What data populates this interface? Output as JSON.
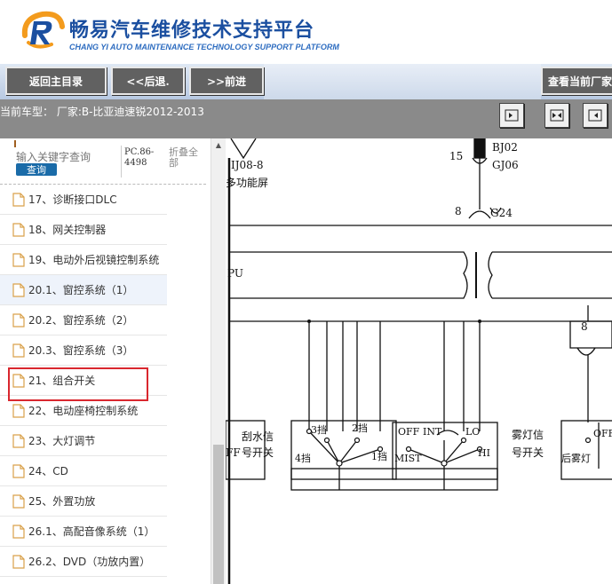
{
  "header": {
    "title_cn": "畅易汽车维修技术支持平台",
    "title_en": "CHANG YI AUTO MAINTENANCE TECHNOLOGY SUPPORT PLATFORM"
  },
  "nav": {
    "home_label": "返回主目录",
    "back_label": "<<后退.",
    "forward_label": ">>前进",
    "view_current_label": "查看当前厂家"
  },
  "car_info": {
    "text": "当前车型： 厂家:B-比亚迪速锐2012-2013"
  },
  "search": {
    "placeholder": "输入关键字查询",
    "button_label": "查询",
    "pc_code": "PC.86-4498",
    "collapse_label": "折叠全部"
  },
  "sidebar": {
    "items": [
      {
        "label": "17、诊断接口DLC"
      },
      {
        "label": "18、网关控制器"
      },
      {
        "label": "19、电动外后视镜控制系统"
      },
      {
        "label": "20.1、窗控系统（1）"
      },
      {
        "label": "20.2、窗控系统（2）"
      },
      {
        "label": "20.3、窗控系统（3）"
      },
      {
        "label": "21、组合开关"
      },
      {
        "label": "22、电动座椅控制系统"
      },
      {
        "label": "23、大灯调节"
      },
      {
        "label": "24、CD"
      },
      {
        "label": "25、外置功放"
      },
      {
        "label": "26.1、高配音像系统（1）"
      },
      {
        "label": "26.2、DVD（功放内置）"
      }
    ],
    "active_index": 3,
    "highlighted_index": 6
  },
  "diagram": {
    "labels": {
      "connector_left": "IJ08-8",
      "multi_screen": "多功能屏",
      "pin_15": "15",
      "bj02": "BJ02",
      "gj06": "GJ06",
      "pin_8": "8",
      "g24": "G24",
      "pu": "PU",
      "pin_8b": "8",
      "wiper_signal_1": "刮水信",
      "wiper_signal_2": "号开关",
      "ff": "FF",
      "gear_3": "3挡",
      "gear_2": "2挡",
      "gear_4": "4挡",
      "gear_1": "1挡",
      "off": "OFF",
      "int": "INT",
      "lo": "LO",
      "mist": "MIST",
      "hi": "HI",
      "fog_signal_1": "雾灯信",
      "fog_signal_2": "号开关",
      "off_right": "OFF",
      "rear_fog": "后雾灯"
    }
  },
  "colors": {
    "brand_blue": "#1b4fa0",
    "nav_button": "#616161",
    "car_bar": "#8a8a8a",
    "highlight_red": "#d9272e",
    "search_button": "#1a6ba8"
  }
}
